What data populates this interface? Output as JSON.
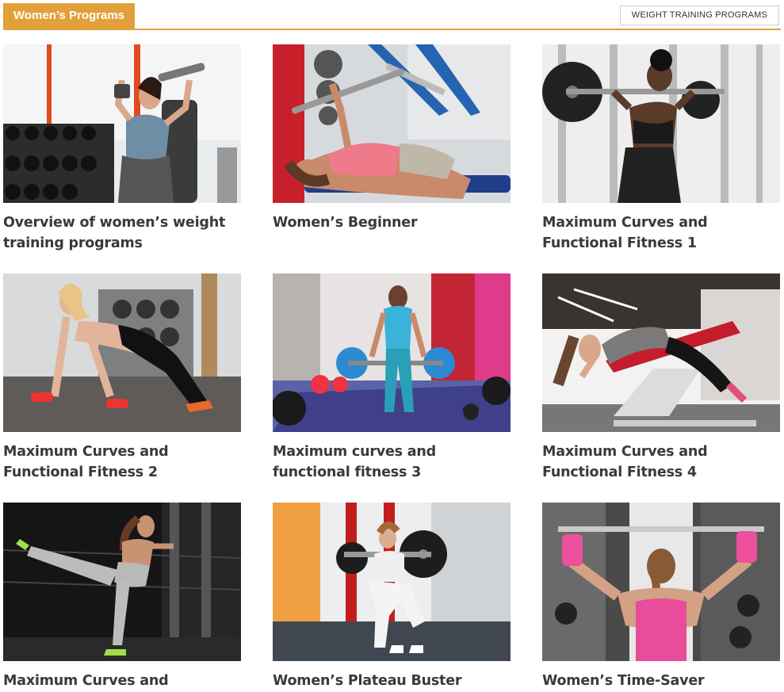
{
  "header": {
    "section_title": "Women’s Programs",
    "more_button_label": "WEIGHT TRAINING PROGRAMS"
  },
  "accent_color": "#e2a03a",
  "programs": [
    {
      "title": "Overview of women’s weight training programs",
      "image": "woman-dumbbell-shoulder-press-photo"
    },
    {
      "title": "Women’s Beginner",
      "image": "woman-bench-press-photo"
    },
    {
      "title": "Maximum Curves and Functional Fitness 1",
      "image": "woman-barbell-squat-rack-photo"
    },
    {
      "title": "Maximum Curves and Functional Fitness 2",
      "image": "woman-plank-dumbbells-photo"
    },
    {
      "title": "Maximum curves and functional fitness 3",
      "image": "woman-deadlift-crossfit-gym-photo"
    },
    {
      "title": "Maximum Curves and Functional Fitness 4",
      "image": "woman-back-extension-photo"
    },
    {
      "title": "Maximum Curves and Functional",
      "image": "woman-cable-kickback-photo"
    },
    {
      "title": "Women’s Plateau Buster",
      "image": "woman-barbell-squat-photo"
    },
    {
      "title": "Women’s Time-Saver",
      "image": "woman-lat-pulldown-photo"
    }
  ]
}
